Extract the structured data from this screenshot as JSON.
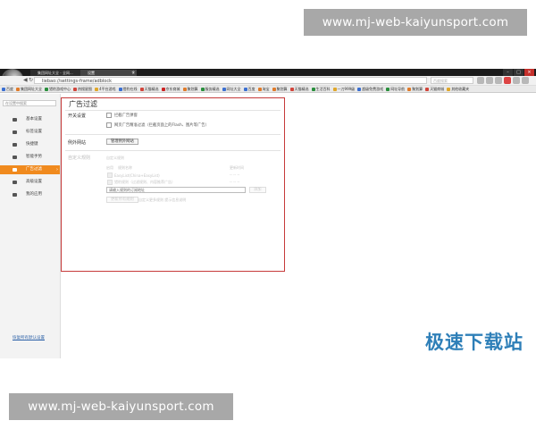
{
  "watermark": {
    "top": "www.mj-web-kaiyunsport.com",
    "bottom": "www.mj-web-kaiyunsport.com"
  },
  "browser": {
    "tabs": [
      {
        "label": "集团网址大全 - 全网..."
      },
      {
        "label": "设置"
      }
    ],
    "new_tab": "+",
    "url": "liebao://settings-frame/adblock",
    "search_placeholder": "百度搜索",
    "window_buttons": [
      "–",
      "□",
      "×"
    ]
  },
  "bookmarks": [
    {
      "label": "百度",
      "color": "#3b6fd1"
    },
    {
      "label": "集团网址大全",
      "color": "#e07b2a"
    },
    {
      "label": "猎豹游戏中心",
      "color": "#2a8f3d"
    },
    {
      "label": "热搜星图",
      "color": "#d1453b"
    },
    {
      "label": "4平台游戏",
      "color": "#e0a72a"
    },
    {
      "label": "猎豹在线",
      "color": "#3b6fd1"
    },
    {
      "label": "天猫精选",
      "color": "#d1453b"
    },
    {
      "label": "京东商城",
      "color": "#c22"
    },
    {
      "label": "聚划算",
      "color": "#e07b2a"
    },
    {
      "label": "服务精选",
      "color": "#2a8f3d"
    },
    {
      "label": "网址大全",
      "color": "#3b6fd1"
    },
    {
      "label": "百度",
      "color": "#3b6fd1"
    },
    {
      "label": "淘宝",
      "color": "#e07b2a"
    },
    {
      "label": "聚划算",
      "color": "#e07b2a"
    },
    {
      "label": "天猫精选",
      "color": "#d1453b"
    },
    {
      "label": "生活百科",
      "color": "#2a8f3d"
    },
    {
      "label": "一刀999级",
      "color": "#e0a72a"
    },
    {
      "label": "超级免费游戏",
      "color": "#3b6fd1"
    },
    {
      "label": "网址导航",
      "color": "#2a8f3d"
    },
    {
      "label": "聚划算",
      "color": "#e07b2a"
    },
    {
      "label": "天猫商城",
      "color": "#d1453b"
    },
    {
      "label": "其他收藏夹",
      "color": "#e0a72a"
    }
  ],
  "sidebar": {
    "search_placeholder": "在设置中搜索",
    "items": [
      {
        "label": "基本设置",
        "active": false
      },
      {
        "label": "标签设置",
        "active": false
      },
      {
        "label": "快捷键",
        "active": false
      },
      {
        "label": "智能手势",
        "active": false
      },
      {
        "label": "广告过滤",
        "active": true
      },
      {
        "label": "高级设置",
        "active": false
      },
      {
        "label": "我的应用",
        "active": false
      }
    ],
    "restore_link": "恢复所有默认设置"
  },
  "panel": {
    "title": "广告过滤",
    "switch_section": "开关设置",
    "switch_options": [
      "拦截广告弹窗",
      "网页广告精准过滤（拦截页面上的Flash、图片等广告）"
    ],
    "exception_section": "例外网站",
    "exception_button": "管理例外网站",
    "rules_section": "自定义规则",
    "rules_subtitle": "自定义规则",
    "list_headers": {
      "enable": "启用",
      "rule": "规则名称",
      "updated": "更新时间"
    },
    "rules": [
      {
        "name": "EasyList(China+EasyList)",
        "time": "-- -- --"
      },
      {
        "name": "猎豹规则（过滤规则、内容推荐广告）",
        "time": "-- -- --"
      }
    ],
    "rule_input_placeholder": "请输入规则的订阅地址",
    "add_button": "添加",
    "bottom_button": "更新所有规则",
    "bottom_note": "自定义更多规则  提示信息说明"
  },
  "brand": "极速下载站"
}
